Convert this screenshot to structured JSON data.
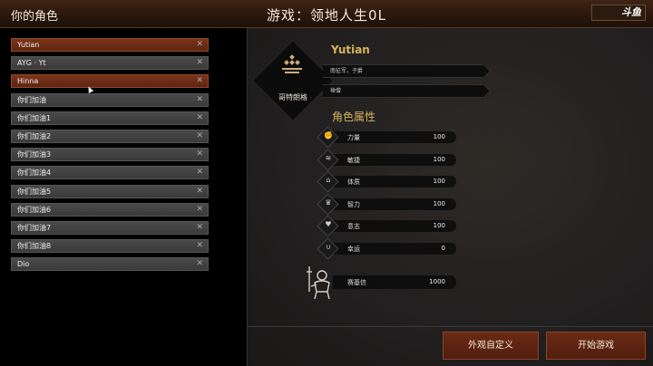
{
  "header": {
    "left_title": "你的角色",
    "center_title": "游戏：领地人生0L",
    "logo_text": "斗鱼"
  },
  "characters": [
    {
      "name": "Yutian",
      "selected": true
    },
    {
      "name": "AYG · Yt",
      "selected": false
    },
    {
      "name": "Hinna",
      "selected": true
    },
    {
      "name": "你们加油",
      "selected": false
    },
    {
      "name": "你们加油1",
      "selected": false
    },
    {
      "name": "你们加油2",
      "selected": false
    },
    {
      "name": "你们加油3",
      "selected": false
    },
    {
      "name": "你们加油4",
      "selected": false
    },
    {
      "name": "你们加油5",
      "selected": false
    },
    {
      "name": "你们加油6",
      "selected": false
    },
    {
      "name": "你们加油7",
      "selected": false
    },
    {
      "name": "你们加油8",
      "selected": false
    },
    {
      "name": "Dio",
      "selected": false
    }
  ],
  "delete_glyph": "✕",
  "profile": {
    "name": "Yutian",
    "faction": "哥特朗格",
    "trait_1": "南征军，子爵",
    "trait_2": "禅僧"
  },
  "attributes_title": "角色属性",
  "attributes": [
    {
      "label": "力量",
      "value": "100",
      "icon": "fist-icon",
      "glyph": "✊"
    },
    {
      "label": "敏捷",
      "value": "100",
      "icon": "feather-icon",
      "glyph": "≋"
    },
    {
      "label": "体质",
      "value": "100",
      "icon": "pillar-icon",
      "glyph": "⌂"
    },
    {
      "label": "智力",
      "value": "100",
      "icon": "brain-icon",
      "glyph": "♛"
    },
    {
      "label": "意志",
      "value": "100",
      "icon": "heart-icon",
      "glyph": "♥"
    },
    {
      "label": "幸运",
      "value": "0",
      "icon": "horseshoe-icon",
      "glyph": "∪"
    }
  ],
  "fame": {
    "label": "赛基信",
    "value": "1000",
    "icon": "knight-icon"
  },
  "buttons": {
    "customize": "外观自定义",
    "start": "开始游戏"
  },
  "colors": {
    "accent_gold": "#d8b45c",
    "selected_red": "#7a3418",
    "button_red": "#6a2a14"
  }
}
